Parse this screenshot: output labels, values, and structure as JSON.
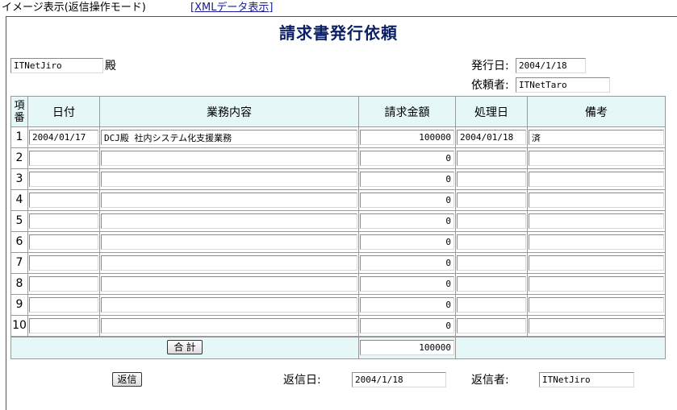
{
  "topbar": {
    "mode_text": "イメージ表示(返信操作モード)",
    "xml_link": "[XMLデータ表示]"
  },
  "title": "請求書発行依頼",
  "recipient": {
    "name": "ITNetJiro",
    "honorific": "殿"
  },
  "issue": {
    "date_label": "発行日:",
    "date_value": "2004/1/18",
    "requester_label": "依頼者:",
    "requester_value": "ITNetTaro"
  },
  "table": {
    "headers": {
      "no": "項番",
      "date": "日付",
      "task": "業務内容",
      "amount": "請求金額",
      "processed": "処理日",
      "note": "備考"
    },
    "rows": [
      {
        "no": "1",
        "date": "2004/01/17",
        "task": "DCJ殿 社内システム化支援業務",
        "amount": "100000",
        "processed": "2004/01/18",
        "note": "済"
      },
      {
        "no": "2",
        "date": "",
        "task": "",
        "amount": "0",
        "processed": "",
        "note": ""
      },
      {
        "no": "3",
        "date": "",
        "task": "",
        "amount": "0",
        "processed": "",
        "note": ""
      },
      {
        "no": "4",
        "date": "",
        "task": "",
        "amount": "0",
        "processed": "",
        "note": ""
      },
      {
        "no": "5",
        "date": "",
        "task": "",
        "amount": "0",
        "processed": "",
        "note": ""
      },
      {
        "no": "6",
        "date": "",
        "task": "",
        "amount": "0",
        "processed": "",
        "note": ""
      },
      {
        "no": "7",
        "date": "",
        "task": "",
        "amount": "0",
        "processed": "",
        "note": ""
      },
      {
        "no": "8",
        "date": "",
        "task": "",
        "amount": "0",
        "processed": "",
        "note": ""
      },
      {
        "no": "9",
        "date": "",
        "task": "",
        "amount": "0",
        "processed": "",
        "note": ""
      },
      {
        "no": "10",
        "date": "",
        "task": "",
        "amount": "0",
        "processed": "",
        "note": ""
      }
    ],
    "total_button": "合 計",
    "total_value": "100000"
  },
  "reply": {
    "button": "返信",
    "date_label": "返信日:",
    "date_value": "2004/1/18",
    "sender_label": "返信者:",
    "sender_value": "ITNetJiro"
  }
}
